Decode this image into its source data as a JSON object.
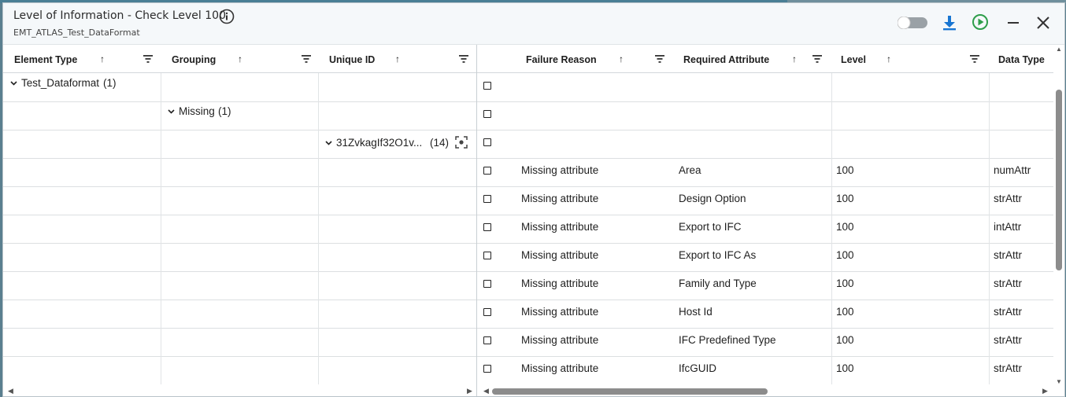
{
  "window": {
    "title": "Level of Information - Check Level 100",
    "subtitle": "EMT_ATLAS_Test_DataFormat"
  },
  "toolbar": {
    "icons": [
      "info-icon",
      "toggle-switch",
      "download-icon",
      "run-icon",
      "minimize-icon",
      "close-icon"
    ]
  },
  "left_columns": [
    "Element Type",
    "Grouping",
    "Unique ID"
  ],
  "right_columns": [
    "Failure Reason",
    "Required Attribute",
    "Level",
    "Data Type"
  ],
  "groups": {
    "element_type": {
      "label": "Test_Dataformat",
      "count": "(1)"
    },
    "grouping": {
      "label": "Missing",
      "count": "(1)"
    },
    "unique_id": {
      "label": "31ZvkagIf32O1v...",
      "count": "(14)"
    }
  },
  "rows": [
    {
      "failure_reason": "Missing attribute",
      "required_attribute": "Area",
      "level": "100",
      "data_type": "numAttr"
    },
    {
      "failure_reason": "Missing attribute",
      "required_attribute": "Design Option",
      "level": "100",
      "data_type": "strAttr"
    },
    {
      "failure_reason": "Missing attribute",
      "required_attribute": "Export to IFC",
      "level": "100",
      "data_type": "intAttr"
    },
    {
      "failure_reason": "Missing attribute",
      "required_attribute": "Export to IFC As",
      "level": "100",
      "data_type": "strAttr"
    },
    {
      "failure_reason": "Missing attribute",
      "required_attribute": "Family and Type",
      "level": "100",
      "data_type": "strAttr"
    },
    {
      "failure_reason": "Missing attribute",
      "required_attribute": "Host Id",
      "level": "100",
      "data_type": "strAttr"
    },
    {
      "failure_reason": "Missing attribute",
      "required_attribute": "IFC Predefined Type",
      "level": "100",
      "data_type": "strAttr"
    },
    {
      "failure_reason": "Missing attribute",
      "required_attribute": "IfcGUID",
      "level": "100",
      "data_type": "strAttr"
    }
  ],
  "colors": {
    "accent_blue": "#1976d2",
    "run_green": "#2e9e4a"
  }
}
